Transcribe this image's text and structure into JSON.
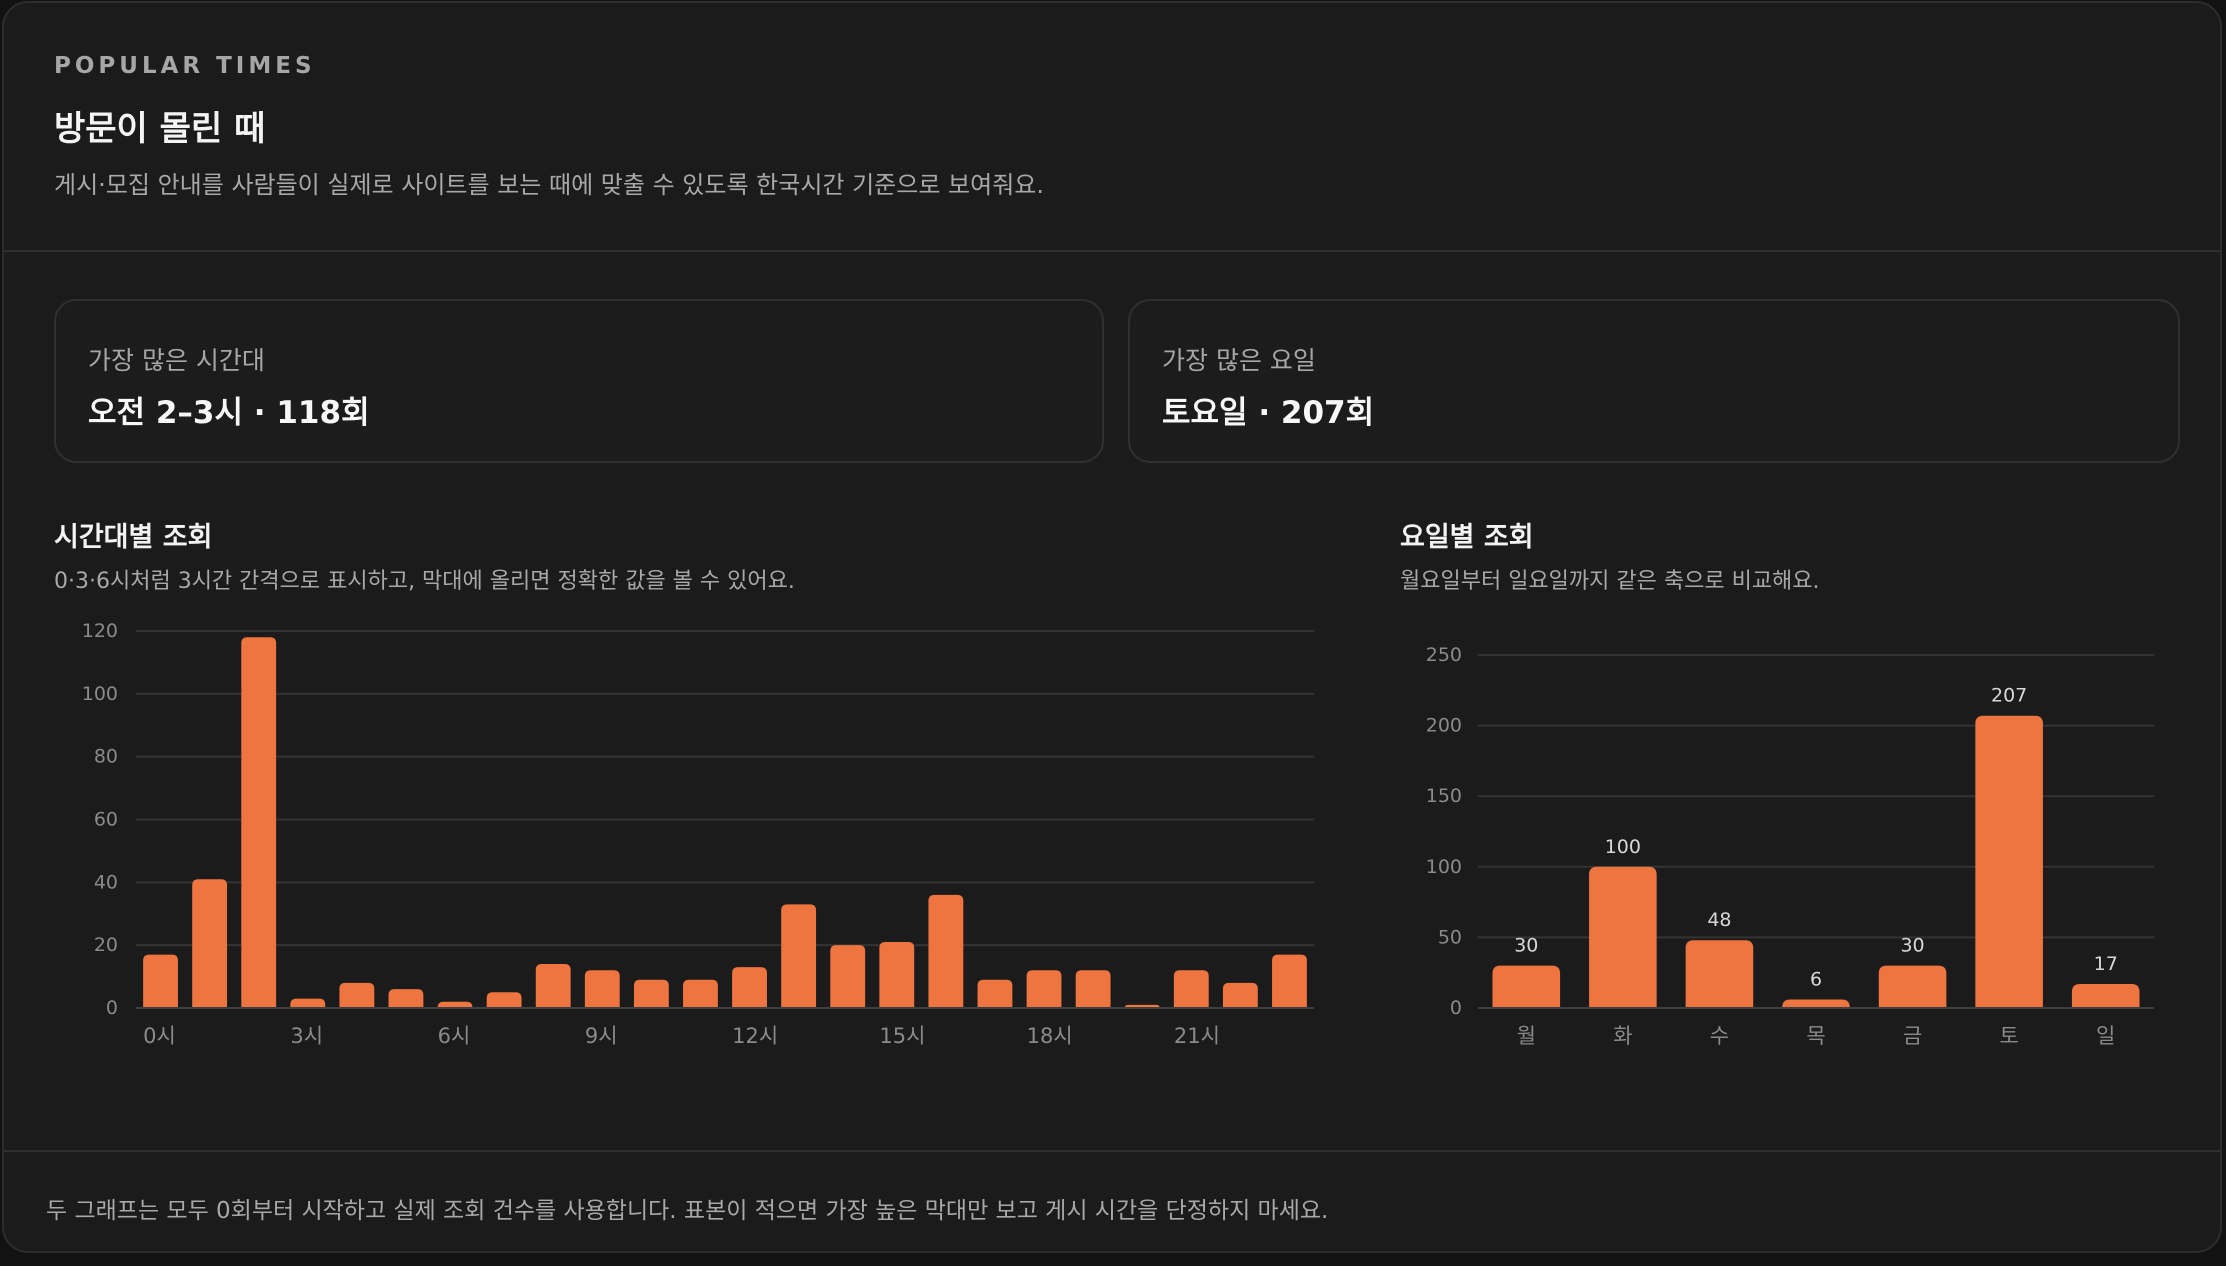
{
  "header": {
    "eyebrow": "POPULAR TIMES",
    "title": "방문이 몰린 때",
    "subtitle": "게시·모집 안내를 사람들이 실제로 사이트를 보는 때에 맞출 수 있도록 한국시간 기준으로 보여줘요."
  },
  "stats": {
    "peak_hour": {
      "label": "가장 많은 시간대",
      "value": "오전 2–3시 · 118회"
    },
    "peak_day": {
      "label": "가장 많은 요일",
      "value": "토요일 · 207회"
    }
  },
  "hourly": {
    "title": "시간대별 조회",
    "desc": "0·3·6시처럼 3시간 간격으로 표시하고, 막대에 올리면 정확한 값을 볼 수 있어요."
  },
  "daily": {
    "title": "요일별 조회",
    "desc": "월요일부터 일요일까지 같은 축으로 비교해요."
  },
  "footer": {
    "note": "두 그래프는 모두 0회부터 시작하고 실제 조회 건수를 사용합니다. 표본이 적으면 가장 높은 막대만 보고 게시 시간을 단정하지 마세요."
  },
  "colors": {
    "bar": "#ee7440",
    "grid": "#333333",
    "tick": "#8a8a8a"
  },
  "chart_data": [
    {
      "type": "bar",
      "categories": [
        "0시",
        "1시",
        "2시",
        "3시",
        "4시",
        "5시",
        "6시",
        "7시",
        "8시",
        "9시",
        "10시",
        "11시",
        "12시",
        "13시",
        "14시",
        "15시",
        "16시",
        "17시",
        "18시",
        "19시",
        "20시",
        "21시",
        "22시",
        "23시"
      ],
      "tick_labels": [
        "0시",
        "3시",
        "6시",
        "9시",
        "12시",
        "15시",
        "18시",
        "21시"
      ],
      "tick_every": 3,
      "values": [
        17,
        41,
        118,
        3,
        8,
        6,
        2,
        5,
        14,
        12,
        9,
        9,
        13,
        33,
        20,
        21,
        36,
        9,
        12,
        12,
        1,
        12,
        8,
        17
      ],
      "ylim": [
        0,
        120
      ],
      "yticks": [
        0,
        20,
        40,
        60,
        80,
        100,
        120
      ],
      "grid": true,
      "data_labels": false
    },
    {
      "type": "bar",
      "categories": [
        "월",
        "화",
        "수",
        "목",
        "금",
        "토",
        "일"
      ],
      "values": [
        30,
        100,
        48,
        6,
        30,
        207,
        17
      ],
      "ylim": [
        0,
        250
      ],
      "yticks": [
        0,
        50,
        100,
        150,
        200,
        250
      ],
      "grid": true,
      "data_labels": true
    }
  ]
}
